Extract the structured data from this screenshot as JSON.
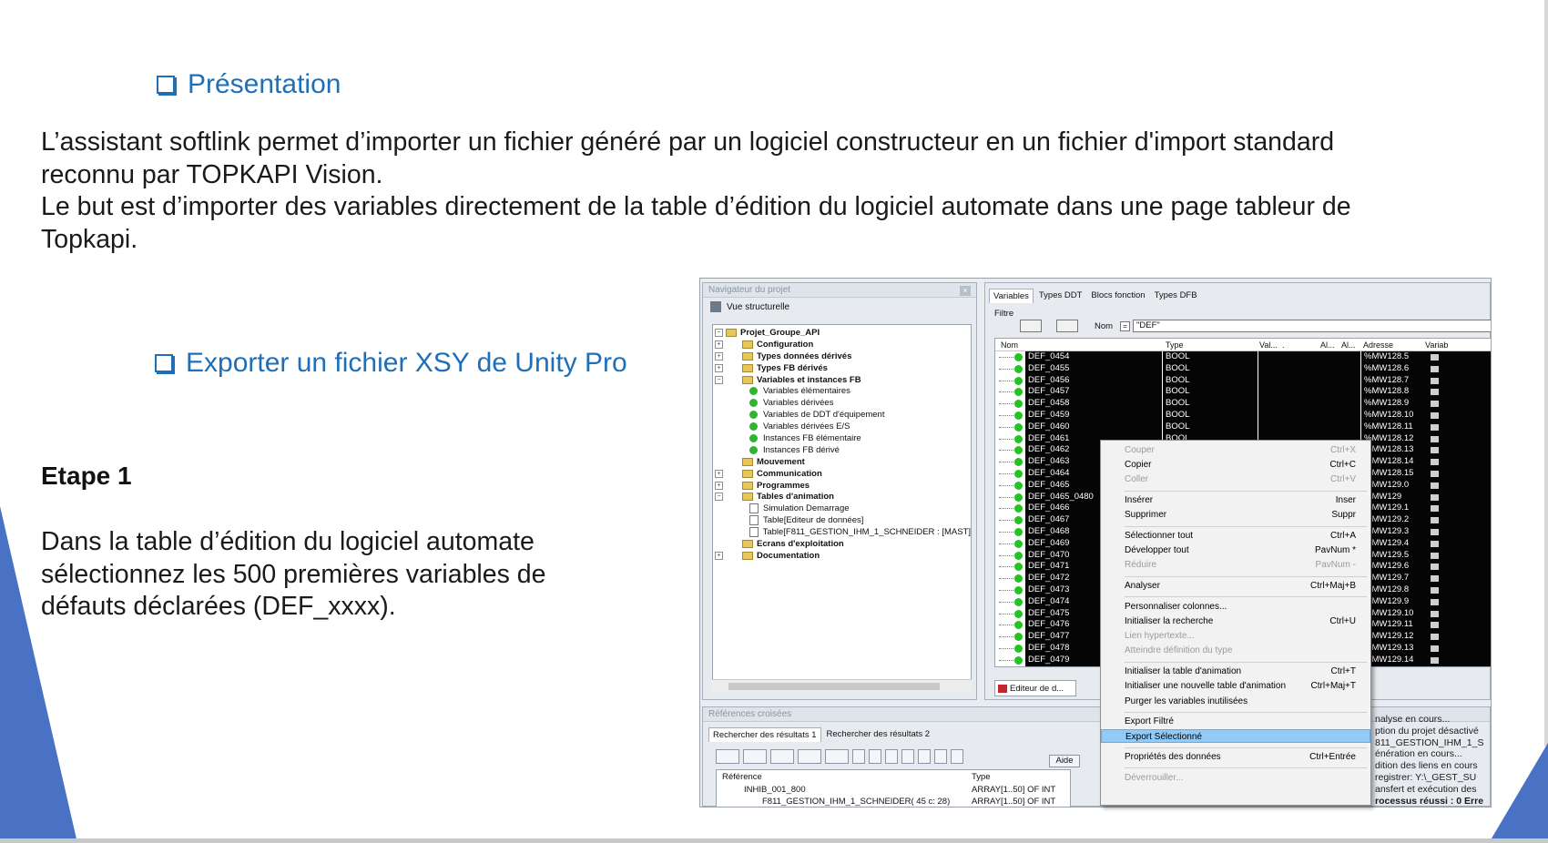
{
  "slide": {
    "heading1": "Présentation",
    "intro_lines": [
      "L’assistant softlink  permet d’importer un fichier généré par un logiciel constructeur en un fichier d'import standard",
      "reconnu par TOPKAPI Vision.",
      "Le but est d’importer des variables directement de la table d’édition du logiciel automate dans une page tableur de",
      "Topkapi."
    ],
    "heading2": "Exporter un fichier XSY de Unity Pro",
    "etape_title": "Etape 1",
    "etape_lines": [
      "Dans la table d’édition du logiciel automate",
      "sélectionnez les 500 premières variables de",
      "défauts déclarées (DEF_xxxx)."
    ],
    "colors": {
      "heading": "#1f6fb8",
      "accent_shape": "#4a72c4"
    }
  },
  "navigator": {
    "title": "Navigateur du projet",
    "view_label": "Vue structurelle",
    "tree": [
      {
        "label": "Projet_Groupe_API",
        "bold": true,
        "toggle": "−",
        "kind": "folder",
        "indent": 1
      },
      {
        "label": "Configuration",
        "bold": true,
        "toggle": "+",
        "kind": "folder",
        "indent": 2
      },
      {
        "label": "Types données dérivés",
        "bold": true,
        "toggle": "+",
        "kind": "folder",
        "indent": 2
      },
      {
        "label": "Types FB dérivés",
        "bold": true,
        "toggle": "+",
        "kind": "folder",
        "indent": 2
      },
      {
        "label": "Variables et instances FB",
        "bold": true,
        "toggle": "−",
        "kind": "folder",
        "indent": 2
      },
      {
        "label": "Variables élémentaires",
        "bold": false,
        "toggle": "",
        "kind": "leaf",
        "indent": 3
      },
      {
        "label": "Variables dérivées",
        "bold": false,
        "toggle": "",
        "kind": "leaf",
        "indent": 3
      },
      {
        "label": "Variables de DDT d'équipement",
        "bold": false,
        "toggle": "",
        "kind": "leaf",
        "indent": 3
      },
      {
        "label": "Variables dérivées E/S",
        "bold": false,
        "toggle": "",
        "kind": "leaf",
        "indent": 3
      },
      {
        "label": "Instances FB élémentaire",
        "bold": false,
        "toggle": "",
        "kind": "leaf",
        "indent": 3
      },
      {
        "label": "Instances FB dérivé",
        "bold": false,
        "toggle": "",
        "kind": "leaf",
        "indent": 3
      },
      {
        "label": "Mouvement",
        "bold": true,
        "toggle": "",
        "kind": "folder",
        "indent": 2
      },
      {
        "label": "Communication",
        "bold": true,
        "toggle": "+",
        "kind": "folder",
        "indent": 2
      },
      {
        "label": "Programmes",
        "bold": true,
        "toggle": "+",
        "kind": "folder",
        "indent": 2
      },
      {
        "label": "Tables d'animation",
        "bold": true,
        "toggle": "−",
        "kind": "folder",
        "indent": 2
      },
      {
        "label": "Simulation Demarrage",
        "bold": false,
        "toggle": "",
        "kind": "doc",
        "indent": 3
      },
      {
        "label": "Table[Editeur de données]",
        "bold": false,
        "toggle": "",
        "kind": "doc",
        "indent": 3
      },
      {
        "label": "Table[F811_GESTION_IHM_1_SCHNEIDER : [MAST]",
        "bold": false,
        "toggle": "",
        "kind": "doc",
        "indent": 3
      },
      {
        "label": "Ecrans d'exploitation",
        "bold": true,
        "toggle": "",
        "kind": "folder",
        "indent": 2
      },
      {
        "label": "Documentation",
        "bold": true,
        "toggle": "+",
        "kind": "folder",
        "indent": 2
      }
    ]
  },
  "editor": {
    "tabs": [
      "Variables",
      "Types DDT",
      "Blocs fonction",
      "Types DFB"
    ],
    "filter_label": "Filtre",
    "nom_label": "Nom",
    "eq_label": "=",
    "filter_value": "\"DEF\"",
    "columns": [
      "Nom",
      "Type",
      "Val...",
      ".",
      "Al...",
      "Al...",
      "Adresse",
      "Variab"
    ],
    "rows": [
      {
        "name": "DEF_0454",
        "type": "BOOL",
        "addr": "%MW128.5"
      },
      {
        "name": "DEF_0455",
        "type": "BOOL",
        "addr": "%MW128.6"
      },
      {
        "name": "DEF_0456",
        "type": "BOOL",
        "addr": "%MW128.7"
      },
      {
        "name": "DEF_0457",
        "type": "BOOL",
        "addr": "%MW128.8"
      },
      {
        "name": "DEF_0458",
        "type": "BOOL",
        "addr": "%MW128.9"
      },
      {
        "name": "DEF_0459",
        "type": "BOOL",
        "addr": "%MW128.10"
      },
      {
        "name": "DEF_0460",
        "type": "BOOL",
        "addr": "%MW128.11"
      },
      {
        "name": "DEF_0461",
        "type": "BOOL",
        "addr": "%MW128.12"
      },
      {
        "name": "DEF_0462",
        "type": "",
        "addr": "%MW128.13"
      },
      {
        "name": "DEF_0463",
        "type": "",
        "addr": "%MW128.14"
      },
      {
        "name": "DEF_0464",
        "type": "",
        "addr": "%MW128.15"
      },
      {
        "name": "DEF_0465",
        "type": "",
        "addr": "%MW129.0"
      },
      {
        "name": "DEF_0465_0480",
        "type": "",
        "addr": "%MW129"
      },
      {
        "name": "DEF_0466",
        "type": "",
        "addr": "%MW129.1"
      },
      {
        "name": "DEF_0467",
        "type": "",
        "addr": "%MW129.2"
      },
      {
        "name": "DEF_0468",
        "type": "",
        "addr": "%MW129.3"
      },
      {
        "name": "DEF_0469",
        "type": "",
        "addr": "%MW129.4"
      },
      {
        "name": "DEF_0470",
        "type": "",
        "addr": "%MW129.5"
      },
      {
        "name": "DEF_0471",
        "type": "",
        "addr": "%MW129.6"
      },
      {
        "name": "DEF_0472",
        "type": "",
        "addr": "%MW129.7"
      },
      {
        "name": "DEF_0473",
        "type": "",
        "addr": "%MW129.8"
      },
      {
        "name": "DEF_0474",
        "type": "",
        "addr": "%MW129.9"
      },
      {
        "name": "DEF_0475",
        "type": "",
        "addr": "%MW129.10"
      },
      {
        "name": "DEF_0476",
        "type": "",
        "addr": "%MW129.11"
      },
      {
        "name": "DEF_0477",
        "type": "",
        "addr": "%MW129.12"
      },
      {
        "name": "DEF_0478",
        "type": "",
        "addr": "%MW129.13"
      },
      {
        "name": "DEF_0479",
        "type": "",
        "addr": "%MW129.14"
      }
    ],
    "bottom_tab": "Editeur de d..."
  },
  "context_menu": {
    "items": [
      {
        "label": "Couper",
        "shortcut": "Ctrl+X",
        "disabled": true
      },
      {
        "label": "Copier",
        "shortcut": "Ctrl+C",
        "disabled": false
      },
      {
        "label": "Coller",
        "shortcut": "Ctrl+V",
        "disabled": true
      },
      {
        "sep": true
      },
      {
        "label": "Insérer",
        "shortcut": "Inser",
        "disabled": false
      },
      {
        "label": "Supprimer",
        "shortcut": "Suppr",
        "disabled": false
      },
      {
        "sep": true
      },
      {
        "label": "Sélectionner tout",
        "shortcut": "Ctrl+A",
        "disabled": false
      },
      {
        "label": "Développer tout",
        "shortcut": "PavNum *",
        "disabled": false
      },
      {
        "label": "Réduire",
        "shortcut": "PavNum -",
        "disabled": true
      },
      {
        "sep": true
      },
      {
        "label": "Analyser",
        "shortcut": "Ctrl+Maj+B",
        "disabled": false
      },
      {
        "sep": true
      },
      {
        "label": "Personnaliser colonnes...",
        "shortcut": "",
        "disabled": false
      },
      {
        "label": "Initialiser la recherche",
        "shortcut": "Ctrl+U",
        "disabled": false
      },
      {
        "label": "Lien hypertexte...",
        "shortcut": "",
        "disabled": true
      },
      {
        "label": "Atteindre définition du type",
        "shortcut": "",
        "disabled": true
      },
      {
        "sep": true
      },
      {
        "label": "Initialiser la table d'animation",
        "shortcut": "Ctrl+T",
        "disabled": false
      },
      {
        "label": "Initialiser une nouvelle table d'animation",
        "shortcut": "Ctrl+Maj+T",
        "disabled": false
      },
      {
        "label": "Purger les variables inutilisées",
        "shortcut": "",
        "disabled": false
      },
      {
        "sep": true
      },
      {
        "label": "Export Filtré",
        "shortcut": "",
        "disabled": false
      },
      {
        "label": "Export Sélectionné",
        "shortcut": "",
        "disabled": false,
        "selected": true
      },
      {
        "sep": true
      },
      {
        "label": "Propriétés des données",
        "shortcut": "Ctrl+Entrée",
        "disabled": false
      },
      {
        "sep": true
      },
      {
        "label": "Déverrouiller...",
        "shortcut": "",
        "disabled": true
      }
    ]
  },
  "refs": {
    "title": "Références croisées",
    "tabs": [
      "Rechercher des résultats 1",
      "Rechercher des résultats 2"
    ],
    "aide": "Aide",
    "col_ref": "Référence",
    "col_type": "Type",
    "row1_ref": "INHIB_001_800",
    "row1_type": "ARRAY[1..50] OF INT",
    "row2_ref": "F811_GESTION_IHM_1_SCHNEIDER( 45 c: 28)",
    "row2_type": "ARRAY[1..50] OF INT",
    "log": [
      "nalyse en cours...",
      "ption du projet désactivé",
      "811_GESTION_IHM_1_S",
      "énération en cours...",
      "dition des liens en cours",
      "registrer: Y:\\_GEST_SU",
      "ansfert et exécution des",
      "rocessus réussi  : 0 Erre"
    ]
  }
}
